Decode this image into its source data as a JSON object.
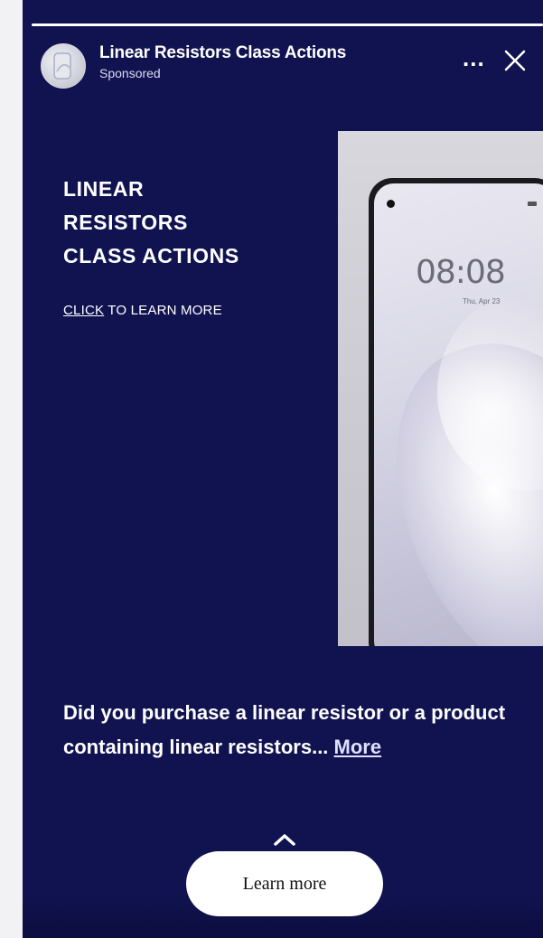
{
  "advertiser": {
    "name": "Linear Resistors Class Actions",
    "label": "Sponsored"
  },
  "header": {
    "more_label": "...",
    "close_icon": "close-icon"
  },
  "creative": {
    "headline_lines": [
      "LINEAR",
      "RESISTORS",
      "CLASS ACTIONS"
    ],
    "cta_underlined": "CLICK",
    "cta_rest": " TO LEARN MORE",
    "phone": {
      "time": "08:08",
      "date": "Thu, Apr 23"
    }
  },
  "body": {
    "text": "Did you purchase a linear resistor or a product containing linear resistors...",
    "more_link": "More"
  },
  "cta": {
    "label": "Learn more",
    "chevron_icon": "chevron-up-icon"
  },
  "colors": {
    "background": "#111351",
    "text": "#ffffff",
    "button": "#ffffff"
  }
}
